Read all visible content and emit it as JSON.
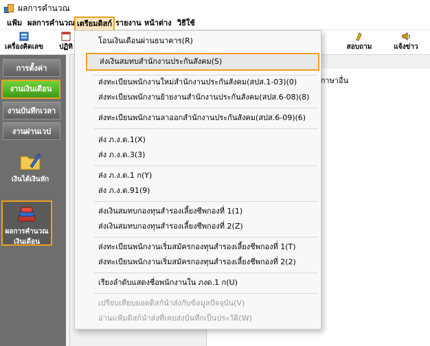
{
  "window": {
    "title": "ผลการคำนวณ"
  },
  "menubar": {
    "items": [
      {
        "label": "แฟ้ม"
      },
      {
        "label": "ผลการคำนวณ"
      },
      {
        "label": "เตรียมดิสก์"
      },
      {
        "label": "รายงาน"
      },
      {
        "label": "หน้าต่าง"
      },
      {
        "label": "วิธีใช้"
      }
    ]
  },
  "toolbar": {
    "buttons": [
      {
        "label": "เครื่องคิดเลข",
        "icon": "calculator-icon"
      },
      {
        "label": "ปฏิทิ",
        "icon": "calendar-icon"
      },
      {
        "label": "สอบถาม",
        "icon": "question-icon"
      },
      {
        "label": "แจ้งข่าว",
        "icon": "speaker-icon"
      }
    ]
  },
  "sidebar": {
    "items": [
      {
        "label": "การตั้งค่า"
      },
      {
        "label": "งานเงินเดือน"
      },
      {
        "label": "งานบันทึกเวลา"
      },
      {
        "label": "งานผ่านเวป"
      }
    ],
    "big_buttons": [
      {
        "label": "เงินได้เงินหัก",
        "icon": "folder-pencil-icon"
      },
      {
        "label_line1": "ผลการคำนวณ",
        "label_line2": "เงินเดือน",
        "icon": "books-icon"
      }
    ]
  },
  "main": {
    "column_text": "นกภาษาอื่น"
  },
  "dropdown": {
    "items": [
      {
        "label": "โอนเงินเดือนผ่านธนาคาร(R)"
      },
      {
        "label": "ส่งเงินสมทบสำนักงานประกันสังคม(S)"
      },
      {
        "label": "ส่งทะเบียนพนักงานใหม่สำนักงานประกันสังคม(สปส.1-03)(0)"
      },
      {
        "label": "ส่งทะเบียนพนักงานย้ายงานสำนักงานประกันสังคม(สปส.6-08)(8)"
      },
      {
        "label": "ส่งทะเบียนพนักงานลาออกสำนักงานประกันสังคม(สปส.6-09)(6)"
      },
      {
        "label": "ส่ง ภ.ง.ด.1(X)"
      },
      {
        "label": "ส่ง ภ.ง.ด.3(3)"
      },
      {
        "label": "ส่ง ภ.ง.ด.1 ก(Y)"
      },
      {
        "label": "ส่ง ภ.ง.ด.91(9)"
      },
      {
        "label": "ส่งเงินสมทบกองทุนสำรองเลี้ยงชีพกองที่ 1(1)"
      },
      {
        "label": "ส่งเงินสมทบกองทุนสำรองเลี้ยงชีพกองที่ 2(Z)"
      },
      {
        "label": "ส่งทะเบียนพนักงานเริ่มสมัครกองทุนสำรองเลี้ยงชีพกองที่ 1(T)"
      },
      {
        "label": "ส่งทะเบียนพนักงานเริ่มสมัครกองทุนสำรองเลี้ยงชีพกองที่ 2(2)"
      },
      {
        "label": "เรียงลำดับแสดงชื่อพนักงานใน  ภงด.1 ก(U)"
      },
      {
        "label": "เปรียบเทียบยอดดิสก์นำส่งกับข้อมูลปัจจุบัน(V)"
      },
      {
        "label": "อ่านแฟ้มดิสก์นำส่งที่เคยส่งบันทึกเป็นประวัติ(W)"
      }
    ]
  },
  "colors": {
    "highlight_border": "#f0a020",
    "selected_nav": "#4fae24",
    "panel_gray": "#6e6e6e"
  }
}
